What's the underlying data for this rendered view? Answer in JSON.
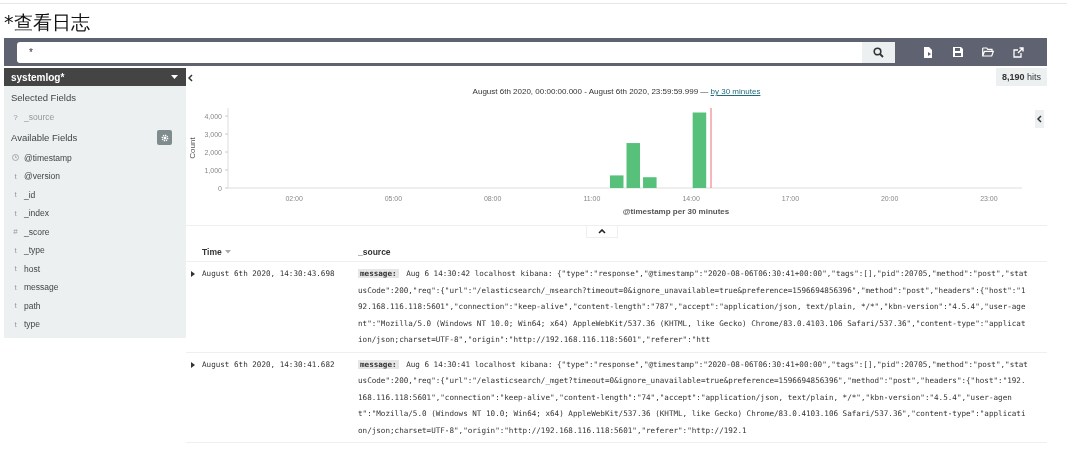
{
  "page_title": "*查看日志",
  "query": {
    "value": "*"
  },
  "sidebar": {
    "index_pattern": "systemlog*",
    "selected_heading": "Selected Fields",
    "selected_fields": [
      {
        "kind": "text",
        "glyph": "?",
        "name": "_source"
      }
    ],
    "available_heading": "Available Fields",
    "available_fields": [
      {
        "kind": "date",
        "name": "@timestamp"
      },
      {
        "kind": "text",
        "glyph": "t",
        "name": "@version"
      },
      {
        "kind": "text",
        "glyph": "t",
        "name": "_id"
      },
      {
        "kind": "text",
        "glyph": "t",
        "name": "_index"
      },
      {
        "kind": "text",
        "glyph": "#",
        "name": "_score"
      },
      {
        "kind": "text",
        "glyph": "t",
        "name": "_type"
      },
      {
        "kind": "text",
        "glyph": "t",
        "name": "host"
      },
      {
        "kind": "text",
        "glyph": "t",
        "name": "message"
      },
      {
        "kind": "text",
        "glyph": "t",
        "name": "path"
      },
      {
        "kind": "text",
        "glyph": "t",
        "name": "type"
      }
    ]
  },
  "hits": {
    "count": "8,190",
    "label": "hits"
  },
  "time_range": {
    "text": "August 6th 2020, 00:00:00.000 - August 6th 2020, 23:59:59.999 —",
    "link": "by 30 minutes"
  },
  "chart_data": {
    "type": "bar",
    "xlabel": "@timestamp per 30 minutes",
    "ylabel": "Count",
    "x": [
      11.75,
      12.25,
      12.75,
      14.25
    ],
    "values": [
      700,
      2500,
      600,
      4200
    ],
    "xlim": [
      0,
      24
    ],
    "ylim": [
      0,
      4450
    ],
    "xticks": [
      {
        "value": 2,
        "label": "02:00"
      },
      {
        "value": 5,
        "label": "05:00"
      },
      {
        "value": 8,
        "label": "08:00"
      },
      {
        "value": 11,
        "label": "11:00"
      },
      {
        "value": 14,
        "label": "14:00"
      },
      {
        "value": 17,
        "label": "17:00"
      },
      {
        "value": 20,
        "label": "20:00"
      },
      {
        "value": 23,
        "label": "23:00"
      }
    ],
    "yticks": [
      {
        "value": 0,
        "label": "0"
      },
      {
        "value": 1000,
        "label": "1,000"
      },
      {
        "value": 2000,
        "label": "2,000"
      },
      {
        "value": 3000,
        "label": "3,000"
      },
      {
        "value": 4000,
        "label": "4,000"
      }
    ],
    "ref_lines": [
      {
        "axis": "x",
        "value": 14.6,
        "color": "#ee8888"
      }
    ]
  },
  "table": {
    "columns": [
      {
        "label": "Time",
        "sorted": true
      },
      {
        "label": "_source",
        "sorted": false
      }
    ],
    "rows": [
      {
        "expanded": false,
        "time": "August 6th 2020, 14:30:43.698",
        "field_label": "message:",
        "text": "Aug 6 14:30:42 localhost kibana: {\"type\":\"response\",\"@timestamp\":\"2020-08-06T06:30:41+00:00\",\"tags\":[],\"pid\":20705,\"method\":\"post\",\"statusCode\":200,\"req\":{\"url\":\"/elasticsearch/_msearch?timeout=0&ignore_unavailable=true&preference=1596694856396\",\"method\":\"post\",\"headers\":{\"host\":\"192.168.116.118:5601\",\"connection\":\"keep-alive\",\"content-length\":\"787\",\"accept\":\"application/json, text/plain, */*\",\"kbn-version\":\"4.5.4\",\"user-agent\":\"Mozilla/5.0 (Windows NT 10.0; Win64; x64) AppleWebKit/537.36 (KHTML, like Gecko) Chrome/83.0.4103.106 Safari/537.36\",\"content-type\":\"application/json;charset=UTF-8\",\"origin\":\"http://192.168.116.118:5601\",\"referer\":\"htt"
      },
      {
        "expanded": false,
        "time": "August 6th 2020, 14:30:41.682",
        "field_label": "message:",
        "text": "Aug 6 14:30:41 localhost kibana: {\"type\":\"response\",\"@timestamp\":\"2020-08-06T06:30:41+00:00\",\"tags\":[],\"pid\":20705,\"method\":\"post\",\"statusCode\":200,\"req\":{\"url\":\"/elasticsearch/_mget?timeout=0&ignore_unavailable=true&preference=1596694856396\",\"method\":\"post\",\"headers\":{\"host\":\"192.168.116.118:5601\",\"connection\":\"keep-alive\",\"content-length\":\"74\",\"accept\":\"application/json, text/plain, */*\",\"kbn-version\":\"4.5.4\",\"user-agent\":\"Mozilla/5.0 (Windows NT 10.0; Win64; x64) AppleWebKit/537.36 (KHTML, like Gecko) Chrome/83.0.4103.106 Safari/537.36\",\"content-type\":\"application/json;charset=UTF-8\",\"origin\":\"http://192.168.116.118:5601\",\"referer\":\"http://192.1"
      }
    ]
  }
}
